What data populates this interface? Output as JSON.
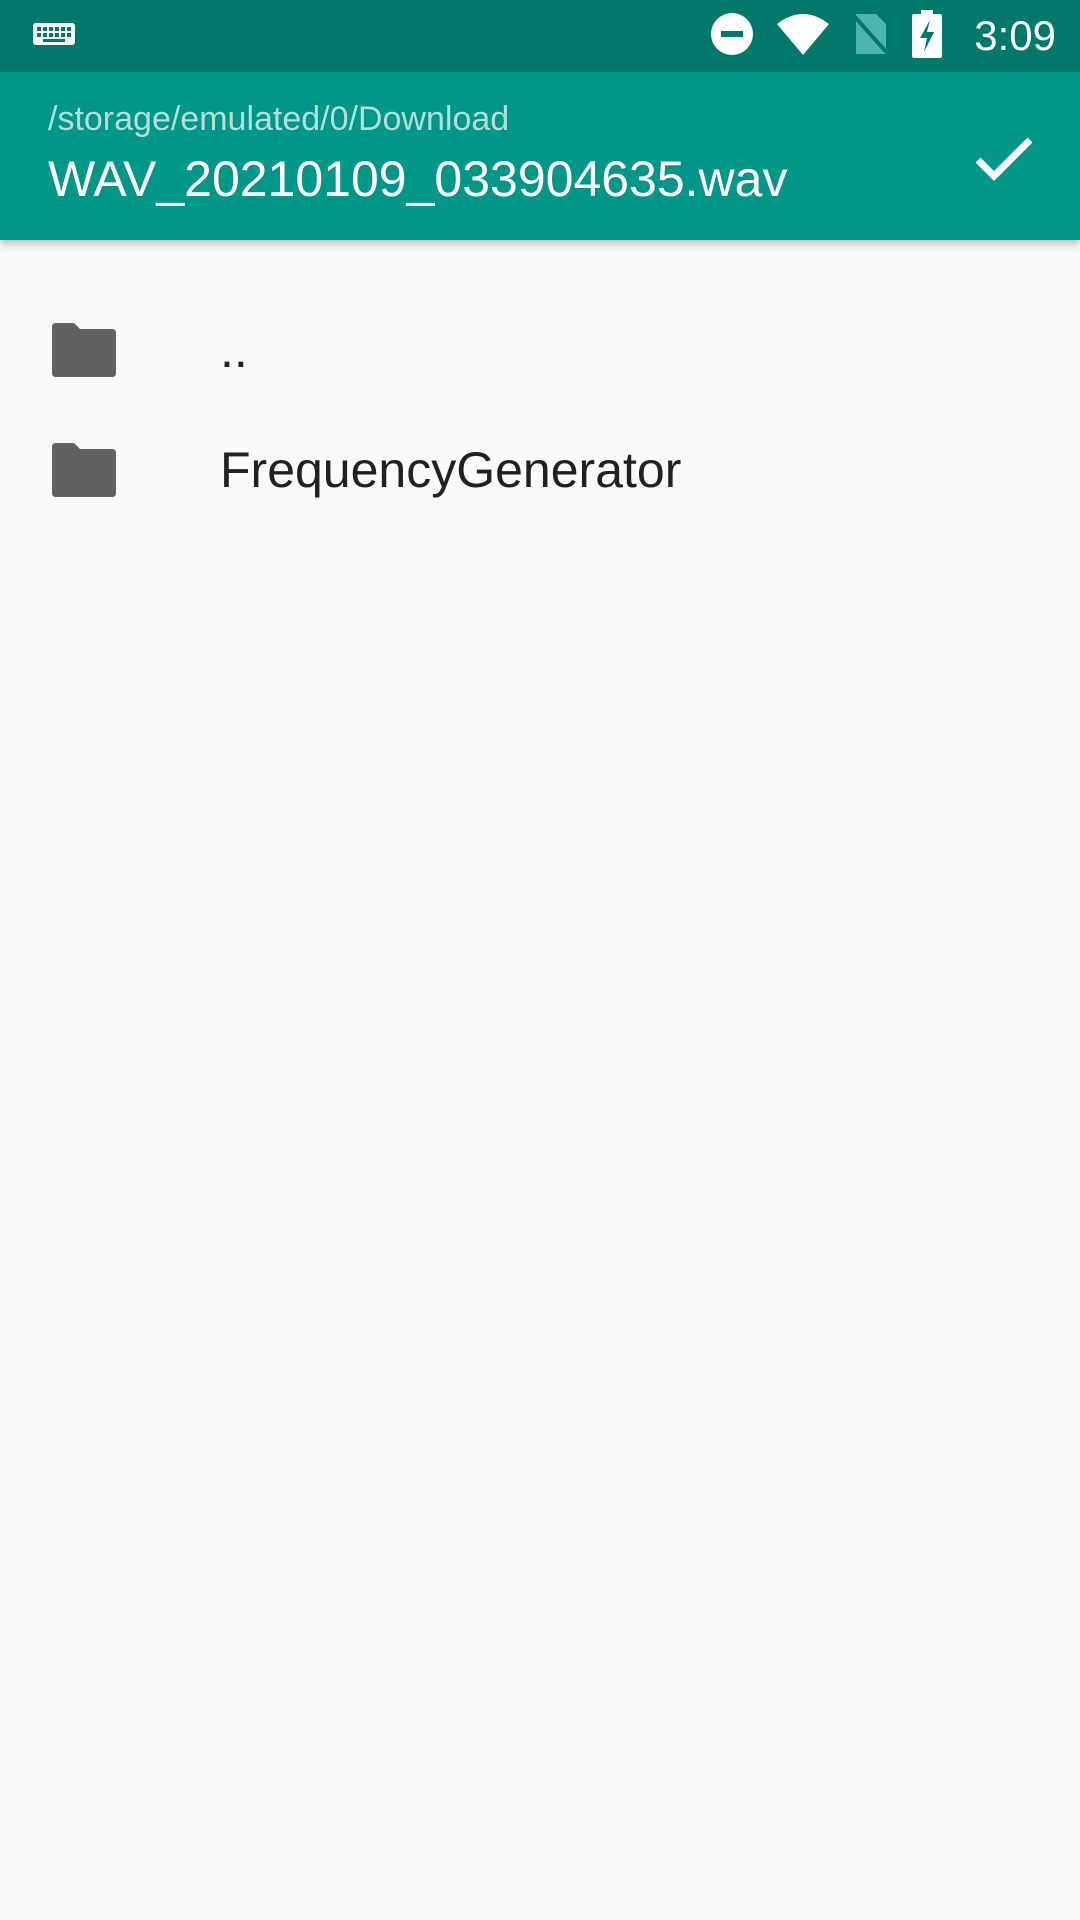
{
  "status_bar": {
    "time": "3:09",
    "icons": [
      "keyboard-icon",
      "do-not-disturb-icon",
      "wifi-icon",
      "no-sim-icon",
      "battery-charging-icon"
    ]
  },
  "app_bar": {
    "path": "/storage/emulated/0/Download",
    "filename": "WAV_20210109_033904635.wav",
    "confirm_icon": "check-icon"
  },
  "file_list": {
    "items": [
      {
        "label": "..",
        "icon": "folder-icon"
      },
      {
        "label": "FrequencyGenerator",
        "icon": "folder-icon"
      }
    ]
  },
  "colors": {
    "status_bar": "#00796b",
    "app_bar": "#009688",
    "background": "#fafafa",
    "folder": "#616161"
  }
}
